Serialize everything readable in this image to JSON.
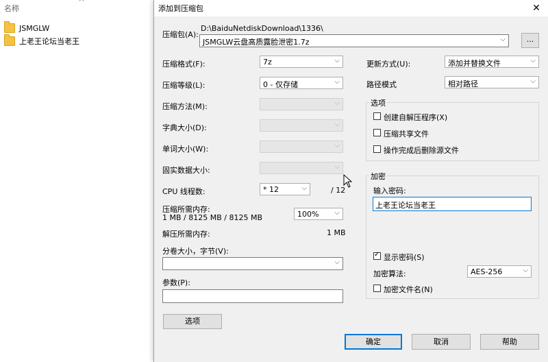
{
  "explorer": {
    "column_header": "名称",
    "files": [
      {
        "name": "JSMGLW"
      },
      {
        "name": "上老王论坛当老王"
      }
    ]
  },
  "dialog": {
    "title": "添加到压缩包",
    "close_glyph": "✕",
    "archive": {
      "label": "压缩包(A):",
      "path": "D:\\BaiduNetdiskDownload\\1336\\",
      "name": "JSMGLW云盘高质露脸泄密1.7z",
      "browse_label": "..."
    },
    "format": {
      "label": "压缩格式(F):",
      "value": "7z"
    },
    "level": {
      "label": "压缩等级(L):",
      "value": "0 - 仅存储"
    },
    "method": {
      "label": "压缩方法(M):",
      "value": ""
    },
    "dict": {
      "label": "字典大小(D):",
      "value": ""
    },
    "word": {
      "label": "单词大小(W):",
      "value": ""
    },
    "solid": {
      "label": "固实数据大小:",
      "value": ""
    },
    "cpu": {
      "label": "CPU 线程数:",
      "value": "* 12",
      "max": "/ 12"
    },
    "mem_compress": {
      "label": "压缩所需内存:",
      "value": "1 MB / 8125 MB / 8125 MB",
      "percent": "100%"
    },
    "mem_decompress": {
      "label": "解压所需内存:",
      "value": "1 MB"
    },
    "split": {
      "label": "分卷大小，字节(V):",
      "value": ""
    },
    "params": {
      "label": "参数(P):",
      "value": ""
    },
    "options_button": "选项",
    "update_mode": {
      "label": "更新方式(U):",
      "value": "添加并替换文件"
    },
    "path_mode": {
      "label": "路径模式",
      "value": "相对路径"
    },
    "options_group": {
      "title": "选项",
      "sfx": {
        "label": "创建自解压程序(X)",
        "checked": false
      },
      "shared": {
        "label": "压缩共享文件",
        "checked": false
      },
      "delete": {
        "label": "操作完成后删除源文件",
        "checked": false
      }
    },
    "encryption": {
      "title": "加密",
      "password_label": "输入密码:",
      "password": "上老王论坛当老王",
      "show_password": {
        "label": "显示密码(S)",
        "checked": true
      },
      "method_label": "加密算法:",
      "method_value": "AES-256",
      "encrypt_names": {
        "label": "加密文件名(N)",
        "checked": false
      }
    },
    "buttons": {
      "ok": "确定",
      "cancel": "取消",
      "help": "帮助"
    }
  }
}
